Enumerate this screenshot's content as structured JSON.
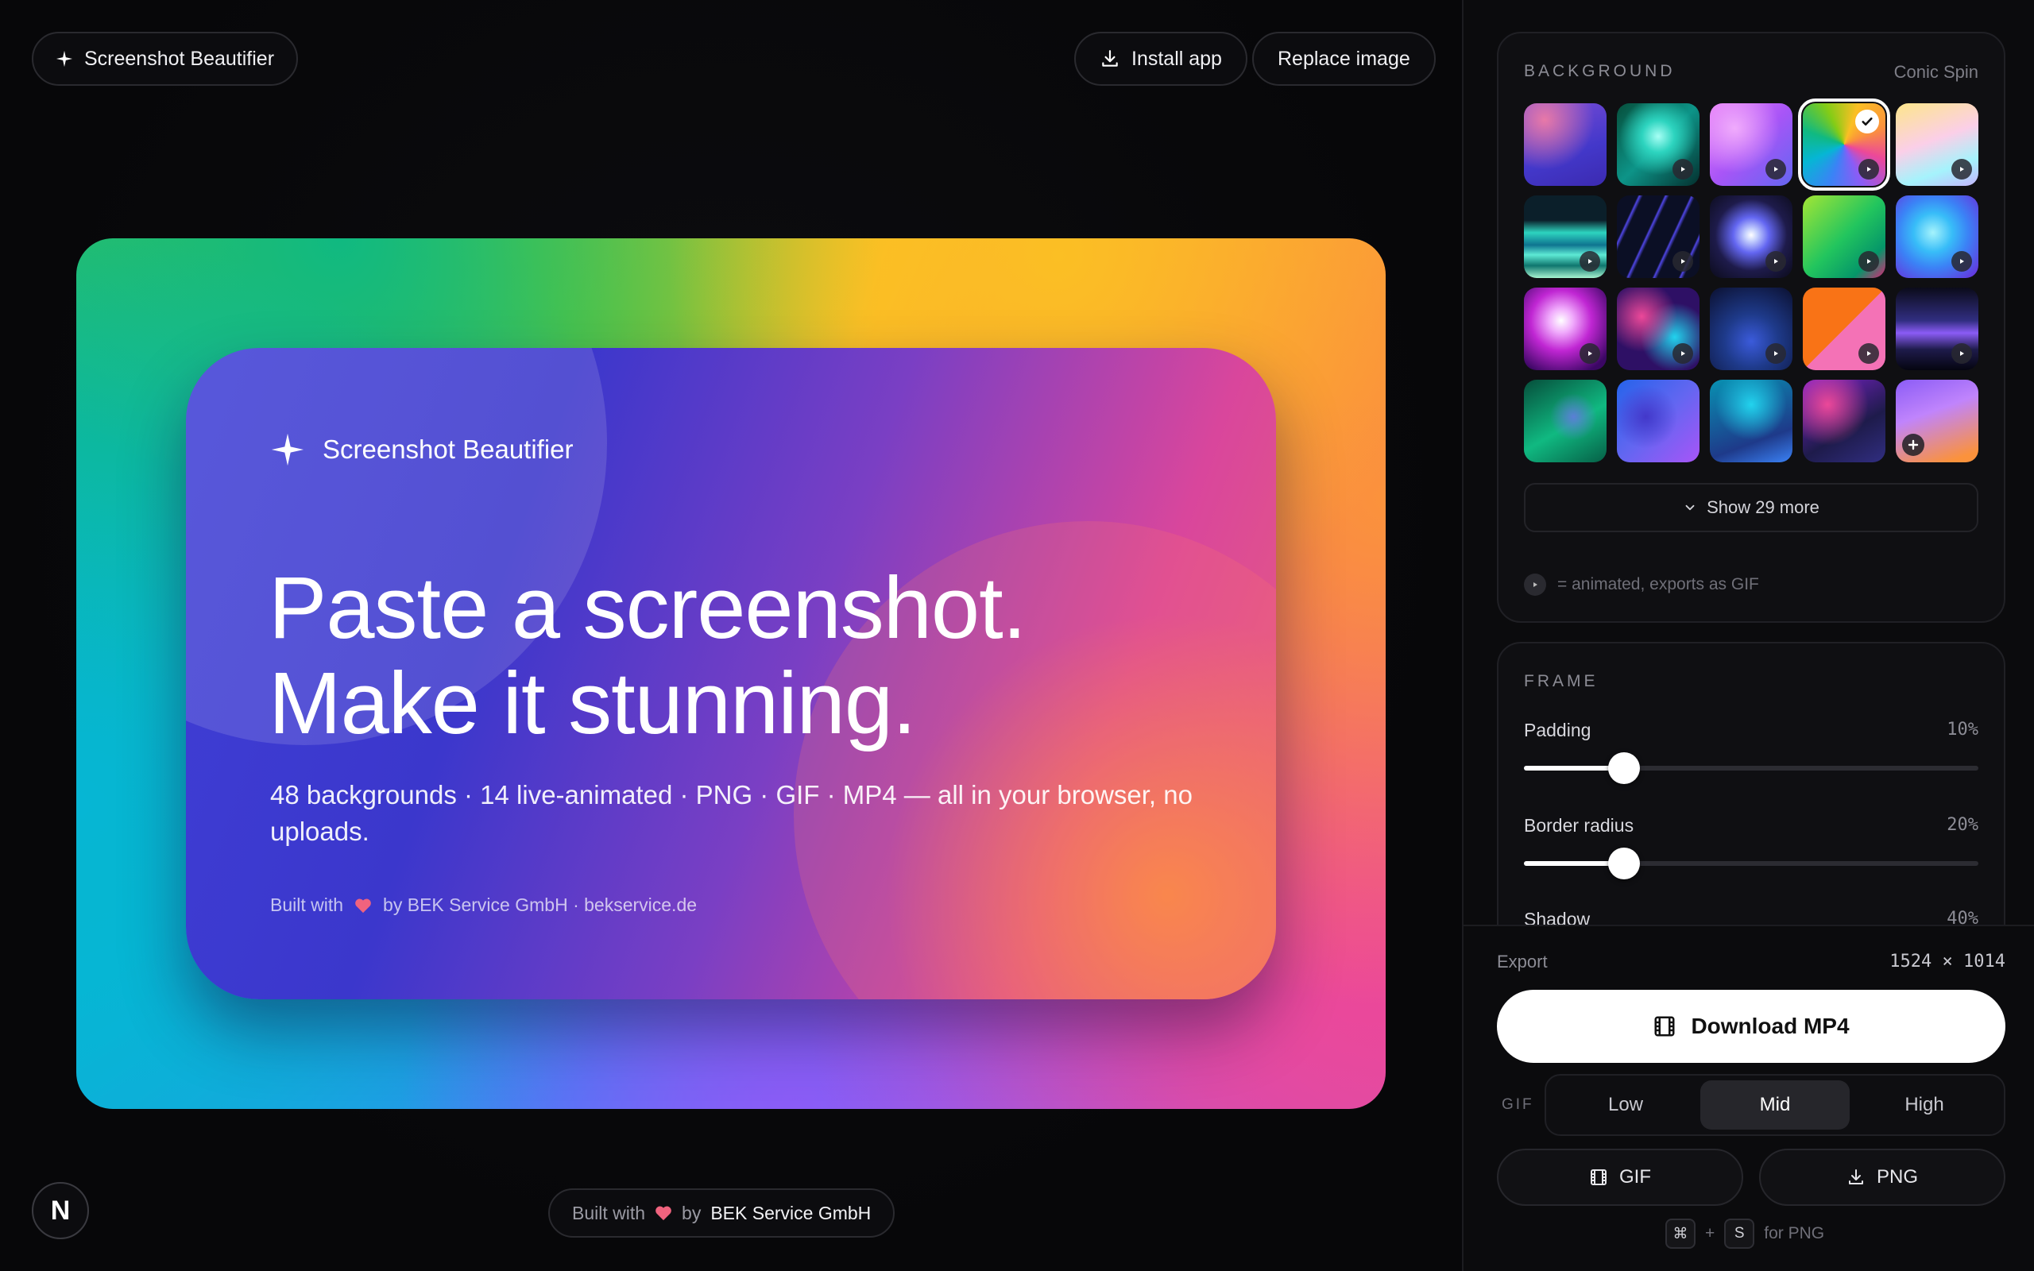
{
  "header": {
    "brand": "Screenshot Beautifier",
    "install": "Install app",
    "replace": "Replace image"
  },
  "preview": {
    "brand": "Screenshot Beautifier",
    "headline_line1": "Paste a screenshot.",
    "headline_line2": "Make it stunning.",
    "subtitle": "48 backgrounds · 14 live-animated · PNG · GIF · MP4 — all in your browser, no uploads.",
    "footer_built": "Built with",
    "footer_by": "by BEK Service GmbH · bekservice.de"
  },
  "footer": {
    "badge": "N",
    "built_with": "Built with",
    "by": "by",
    "company": "BEK Service GmbH"
  },
  "background": {
    "title": "BACKGROUND",
    "current": "Conic Spin",
    "show_more": "Show 29 more",
    "legend": "= animated, exports as GIF",
    "selected_index": 3,
    "swatches": [
      {
        "name": "pink-indigo",
        "animated": false
      },
      {
        "name": "teal-glow",
        "animated": true
      },
      {
        "name": "violet-pink",
        "animated": true
      },
      {
        "name": "conic-spin",
        "animated": true
      },
      {
        "name": "pastel-peach",
        "animated": true
      },
      {
        "name": "teal-waves",
        "animated": true
      },
      {
        "name": "diagonal-lines",
        "animated": true
      },
      {
        "name": "indigo-orb",
        "animated": true
      },
      {
        "name": "lime-emerald",
        "animated": true
      },
      {
        "name": "cyan-blue-glow",
        "animated": true
      },
      {
        "name": "magenta-orb",
        "animated": true
      },
      {
        "name": "pink-cyan-aurora",
        "animated": true
      },
      {
        "name": "deep-blue",
        "animated": true
      },
      {
        "name": "orange-pink-split",
        "animated": true
      },
      {
        "name": "night-horizon",
        "animated": true
      },
      {
        "name": "emerald-mesh",
        "animated": false
      },
      {
        "name": "blue-indigo-mesh",
        "animated": false
      },
      {
        "name": "cyan-teal-mesh",
        "animated": false
      },
      {
        "name": "pink-navy-mesh",
        "animated": false
      },
      {
        "name": "custom-gradient",
        "animated": false
      }
    ]
  },
  "frame": {
    "title": "FRAME",
    "padding_label": "Padding",
    "padding_value": "10%",
    "padding_fraction": 0.22,
    "radius_label": "Border radius",
    "radius_value": "20%",
    "radius_fraction": 0.22,
    "shadow_label": "Shadow",
    "shadow_value": "40%"
  },
  "export": {
    "label": "Export",
    "size": "1524 × 1014",
    "download": "Download MP4",
    "gif_label": "GIF",
    "quality": [
      "Low",
      "Mid",
      "High"
    ],
    "quality_active": "Mid",
    "gif_button": "GIF",
    "png_button": "PNG",
    "shortcut_key1": "⌘",
    "shortcut_plus": "+",
    "shortcut_key2": "S",
    "shortcut_hint": "for PNG"
  }
}
